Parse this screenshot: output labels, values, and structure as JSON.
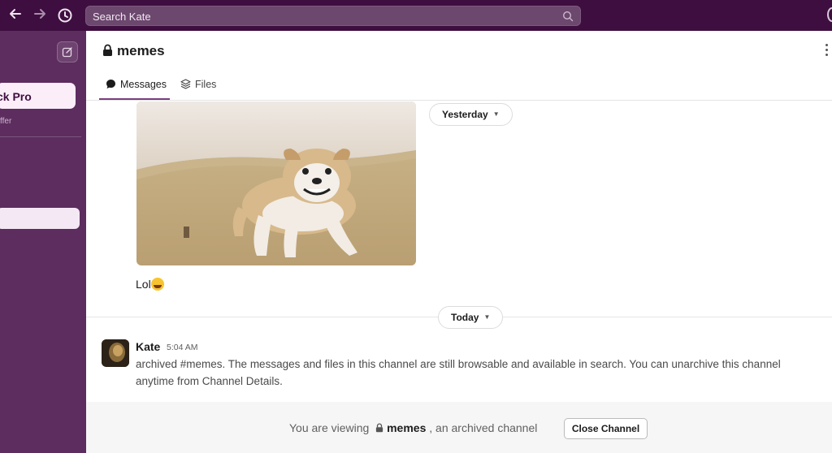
{
  "topbar": {
    "search_placeholder": "Search Kate"
  },
  "sidebar": {
    "pro_label": "ck Pro",
    "offer_text": "ffer"
  },
  "channel": {
    "name": "memes",
    "tabs": [
      {
        "label": "Messages",
        "icon": "message-bubble-icon",
        "active": true
      },
      {
        "label": "Files",
        "icon": "layers-icon",
        "active": false
      }
    ]
  },
  "messages": {
    "gif_alt": "dog-gif",
    "yesterday_label": "Yesterday",
    "lol_text": "Lol",
    "today_label": "Today",
    "system_message": {
      "author": "Kate",
      "time": "5:04 AM",
      "body": "archived #memes. The messages and files in this channel are still browsable and available in search. You can unarchive this channel anytime from Channel Details."
    }
  },
  "footer": {
    "prefix": "You are viewing",
    "channel": "memes",
    "suffix": ", an archived channel",
    "close_button": "Close Channel"
  },
  "colors": {
    "aubergine": "#3f0e40",
    "sidebar": "#5d2d5f",
    "tab_accent": "#7a3e80"
  }
}
